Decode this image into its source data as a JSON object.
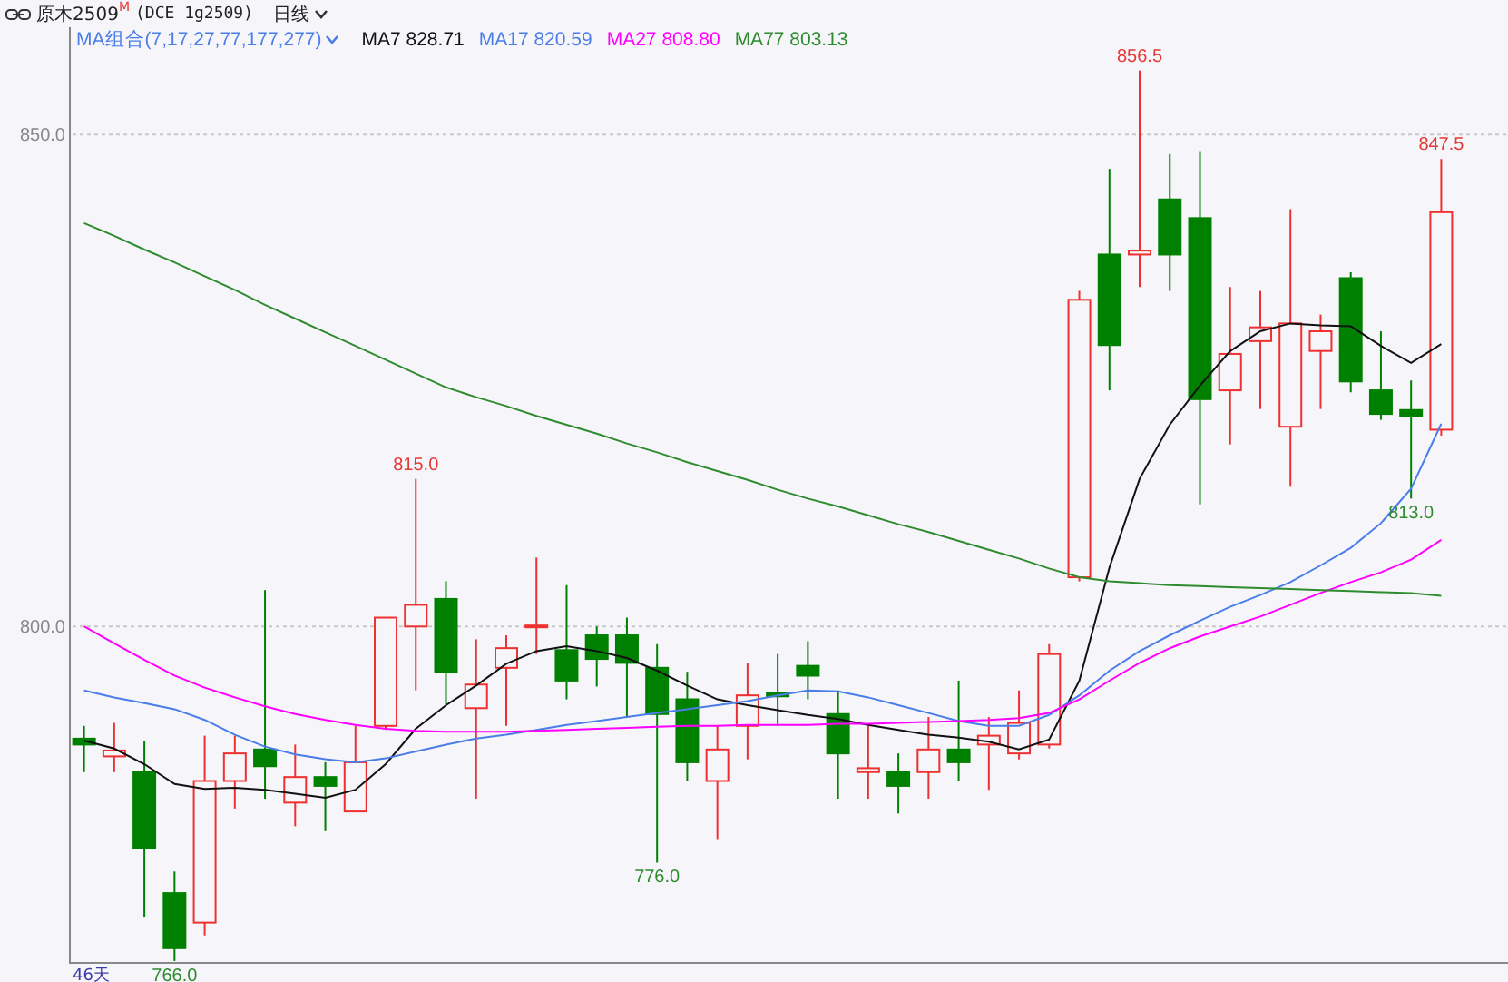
{
  "header": {
    "symbol": "原木2509",
    "symbol_mark": "M",
    "exchange": "(DCE 1g2509)",
    "period": "日线"
  },
  "legend": {
    "indicator": "MA组合(7,17,27,77,177,277)",
    "items": [
      {
        "value": "828.71"
      },
      {
        "value": "820.59"
      },
      {
        "value": "808.80"
      },
      {
        "value": "803.13"
      }
    ]
  },
  "chart_data": {
    "type": "candlestick",
    "ylim": [
      765.9,
      860.9
    ],
    "yticks": [
      {
        "value": 800,
        "label": "800.0"
      },
      {
        "value": 850,
        "label": "850.0"
      }
    ],
    "series": [
      {
        "name": "MA7",
        "color": "#111111",
        "type": "line",
        "values": [
          788.4,
          787.6,
          786.0,
          784.0,
          783.5,
          783.6,
          783.4,
          783.0,
          782.6,
          783.4,
          786.0,
          789.6,
          792.0,
          794.0,
          796.2,
          797.5,
          798.0,
          797.5,
          796.8,
          795.5,
          794.0,
          792.6,
          792.0,
          791.5,
          791.0,
          790.6,
          790.0,
          789.5,
          789.0,
          788.7,
          788.3,
          787.5,
          788.5,
          794.5,
          806.0,
          815.0,
          820.5,
          824.5,
          828.0,
          830.0,
          830.8,
          830.6,
          830.5,
          828.5,
          826.8,
          828.7
        ]
      },
      {
        "name": "MA17",
        "color": "#4a7de8",
        "type": "line",
        "values": [
          793.5,
          792.8,
          792.2,
          791.6,
          790.5,
          789.0,
          787.8,
          787.0,
          786.5,
          786.2,
          786.6,
          787.3,
          788.0,
          788.6,
          789.0,
          789.5,
          790.0,
          790.4,
          790.8,
          791.2,
          791.6,
          792.0,
          792.4,
          793.0,
          793.5,
          793.4,
          792.8,
          792.0,
          791.2,
          790.4,
          789.9,
          789.9,
          791.0,
          793.0,
          795.5,
          797.5,
          799.1,
          800.6,
          802.0,
          803.2,
          804.5,
          806.2,
          808.0,
          810.5,
          814.0,
          820.6
        ]
      },
      {
        "name": "MA27",
        "color": "#ff00ff",
        "type": "line",
        "values": [
          800.0,
          798.3,
          796.6,
          795.0,
          793.8,
          792.8,
          791.9,
          791.1,
          790.5,
          790.0,
          789.6,
          789.4,
          789.3,
          789.3,
          789.3,
          789.4,
          789.5,
          789.6,
          789.7,
          789.8,
          789.9,
          789.9,
          790.0,
          790.0,
          790.0,
          790.1,
          790.1,
          790.2,
          790.3,
          790.4,
          790.5,
          790.7,
          791.2,
          792.6,
          794.5,
          796.3,
          797.8,
          799.0,
          800.0,
          801.0,
          802.2,
          803.4,
          804.5,
          805.5,
          806.8,
          808.8
        ]
      },
      {
        "name": "MA77",
        "color": "#2e8b2e",
        "type": "line",
        "values": [
          841.0,
          839.7,
          838.3,
          837.0,
          835.6,
          834.2,
          832.7,
          831.3,
          829.9,
          828.5,
          827.1,
          825.7,
          824.3,
          823.3,
          822.4,
          821.4,
          820.5,
          819.6,
          818.6,
          817.7,
          816.7,
          815.8,
          814.9,
          813.9,
          813.0,
          812.2,
          811.3,
          810.4,
          809.6,
          808.7,
          807.8,
          806.9,
          805.9,
          805.0,
          804.6,
          804.4,
          804.2,
          804.1,
          804.0,
          803.9,
          803.8,
          803.7,
          803.6,
          803.5,
          803.4,
          803.1
        ]
      }
    ],
    "ohlc": [
      [
        788.6,
        789.9,
        785.2,
        788.0
      ],
      [
        786.8,
        790.2,
        785.2,
        787.4
      ],
      [
        785.2,
        788.4,
        770.5,
        777.5
      ],
      [
        772.9,
        775.1,
        766.0,
        767.3
      ],
      [
        769.9,
        788.9,
        768.6,
        784.3
      ],
      [
        784.3,
        788.9,
        781.5,
        787.1
      ],
      [
        787.5,
        803.7,
        782.5,
        785.8
      ],
      [
        782.1,
        788.0,
        779.7,
        784.7
      ],
      [
        784.7,
        786.2,
        779.2,
        783.8
      ],
      [
        781.2,
        789.9,
        781.2,
        786.2
      ],
      [
        789.9,
        800.9,
        789.5,
        800.9
      ],
      [
        800.0,
        815.0,
        793.5,
        802.2
      ],
      [
        802.8,
        804.6,
        792.1,
        795.4
      ],
      [
        791.7,
        798.7,
        782.5,
        794.1
      ],
      [
        795.8,
        799.1,
        789.9,
        797.8
      ],
      [
        800.0,
        807.0,
        797.2,
        800.1
      ],
      [
        797.6,
        804.2,
        792.6,
        794.5
      ],
      [
        799.1,
        800.0,
        793.9,
        796.7
      ],
      [
        799.1,
        800.9,
        790.8,
        796.3
      ],
      [
        795.8,
        798.2,
        776.0,
        791.1
      ],
      [
        792.6,
        795.4,
        784.3,
        786.2
      ],
      [
        784.3,
        789.9,
        778.4,
        787.5
      ],
      [
        789.9,
        796.3,
        786.5,
        793.0
      ],
      [
        793.2,
        797.2,
        789.9,
        792.9
      ],
      [
        796.0,
        798.5,
        792.6,
        795.0
      ],
      [
        791.1,
        793.5,
        782.5,
        787.1
      ],
      [
        785.2,
        789.9,
        782.5,
        785.6
      ],
      [
        785.2,
        787.1,
        781.0,
        783.8
      ],
      [
        785.2,
        790.8,
        782.5,
        787.5
      ],
      [
        787.5,
        794.5,
        784.3,
        786.2
      ],
      [
        788.0,
        790.8,
        783.4,
        788.9
      ],
      [
        787.1,
        793.5,
        786.5,
        790.2
      ],
      [
        788.0,
        798.2,
        787.6,
        797.2
      ],
      [
        805.0,
        834.1,
        804.6,
        833.2
      ],
      [
        837.8,
        846.5,
        824.0,
        828.6
      ],
      [
        837.8,
        856.5,
        834.5,
        838.2
      ],
      [
        843.4,
        848.0,
        834.1,
        837.8
      ],
      [
        841.5,
        848.3,
        812.4,
        823.1
      ],
      [
        824.0,
        834.5,
        818.5,
        827.7
      ],
      [
        829.0,
        834.1,
        822.1,
        830.4
      ],
      [
        820.3,
        842.4,
        814.2,
        830.8
      ],
      [
        828.0,
        831.7,
        822.1,
        830.0
      ],
      [
        835.4,
        836.0,
        823.8,
        824.9
      ],
      [
        824.0,
        830.0,
        821.0,
        821.6
      ],
      [
        822.0,
        825.0,
        813.0,
        821.4
      ],
      [
        820.0,
        847.5,
        819.4,
        842.1
      ]
    ],
    "annotations": [
      "815.0",
      "856.5",
      "847.5",
      "766.0",
      "776.0",
      "813.0"
    ]
  },
  "day_count": "46天"
}
